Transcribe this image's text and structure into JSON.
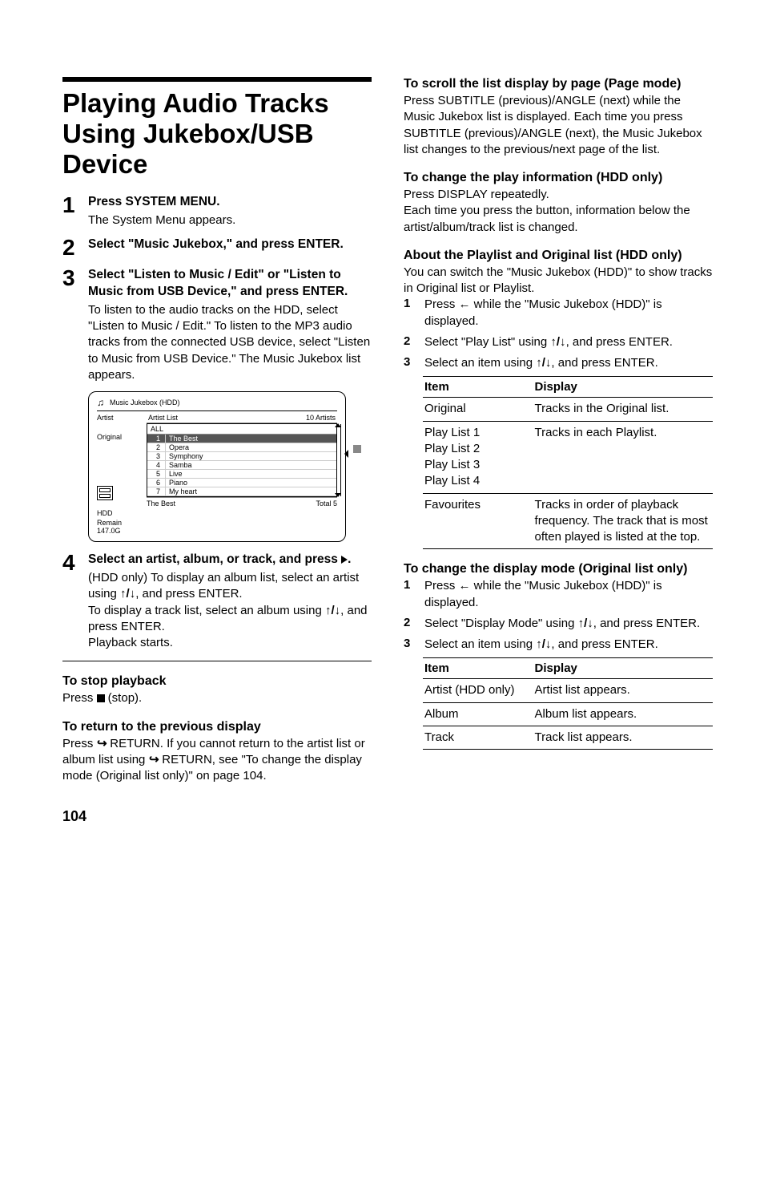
{
  "page_number": "104",
  "left": {
    "main_title": "Playing Audio Tracks Using Jukebox/USB Device",
    "steps": [
      {
        "num": "1",
        "head": "Press SYSTEM MENU.",
        "body": "The System Menu appears."
      },
      {
        "num": "2",
        "head": "Select \"Music Jukebox,\" and press ENTER.",
        "body": ""
      },
      {
        "num": "3",
        "head": "Select \"Listen to Music / Edit\" or \"Listen to Music from USB Device,\" and press ENTER.",
        "body": "To listen to the audio tracks on the HDD, select \"Listen to Music / Edit.\" To listen to the MP3 audio tracks from the connected USB device, select \"Listen to Music from USB Device.\" The Music Jukebox list appears."
      },
      {
        "num": "4",
        "head_a": "Select an artist, album, or track, and press ",
        "head_b": ".",
        "body_a": "(HDD only) To display an album list, select an artist using ",
        "body_b": ", and press ENTER.",
        "body_c": "To display a track list, select an album using ",
        "body_d": ", and press ENTER.",
        "body_e": "Playback starts."
      }
    ],
    "jukebox": {
      "title": "Music Jukebox (HDD)",
      "left_artist": "Artist",
      "left_original": "Original",
      "header_left": "Artist List",
      "header_right": "10 Artists",
      "all": "ALL",
      "items": [
        {
          "n": "1",
          "t": "The Best"
        },
        {
          "n": "2",
          "t": "Opera"
        },
        {
          "n": "3",
          "t": "Symphony"
        },
        {
          "n": "4",
          "t": "Samba"
        },
        {
          "n": "5",
          "t": "Live"
        },
        {
          "n": "6",
          "t": "Piano"
        },
        {
          "n": "7",
          "t": "My heart"
        }
      ],
      "footer_left": "The Best",
      "footer_right": "Total 5",
      "bottom_left": "HDD",
      "remain_label": "Remain",
      "remain_val": "147.0G"
    },
    "stop_h": "To stop playback",
    "stop_a": "Press ",
    "stop_b": " (stop).",
    "return_h": "To return to the previous display",
    "return_a": "Press ",
    "return_b": " RETURN. If you cannot return to the artist list or album list using ",
    "return_c": " RETURN, see \"To change the display mode (Original list only)\" on page 104."
  },
  "right": {
    "scroll_h": "To scroll the list display by page (Page mode)",
    "scroll_b": "Press SUBTITLE (previous)/ANGLE (next) while the Music Jukebox list is displayed. Each time you press SUBTITLE (previous)/ANGLE (next), the Music Jukebox list changes to the previous/next page of the list.",
    "change_info_h": "To change the play information (HDD only)",
    "change_info_b1": "Press DISPLAY repeatedly.",
    "change_info_b2": "Each time you press the button, information below the artist/album/track list is changed.",
    "about_h": "About the Playlist and Original list (HDD only)",
    "about_b": "You can switch the \"Music Jukebox (HDD)\" to show tracks in Original list or Playlist.",
    "substeps1": [
      {
        "n": "1",
        "a": "Press ",
        "b": " while the \"Music Jukebox (HDD)\" is displayed."
      },
      {
        "n": "2",
        "a": "Select \"Play List\" using ",
        "b": ", and press ENTER."
      },
      {
        "n": "3",
        "a": "Select an item using ",
        "b": ", and press ENTER."
      }
    ],
    "table1_h_item": "Item",
    "table1_h_disp": "Display",
    "table1": [
      {
        "item": "Original",
        "disp": "Tracks in the Original list."
      },
      {
        "item": "Play List 1\nPlay List 2\nPlay List 3\nPlay List 4",
        "disp": "Tracks in each Playlist."
      },
      {
        "item": "Favourites",
        "disp": "Tracks in order of playback frequency. The track that is most often played is listed at the top."
      }
    ],
    "mode_h": "To change the display mode (Original list only)",
    "substeps2": [
      {
        "n": "1",
        "a": "Press ",
        "b": " while the \"Music Jukebox (HDD)\" is displayed."
      },
      {
        "n": "2",
        "a": "Select \"Display Mode\" using ",
        "b": ", and press ENTER."
      },
      {
        "n": "3",
        "a": "Select an item using ",
        "b": ", and press ENTER."
      }
    ],
    "table2_h_item": "Item",
    "table2_h_disp": "Display",
    "table2": [
      {
        "item": "Artist (HDD only)",
        "disp": "Artist list appears."
      },
      {
        "item": "Album",
        "disp": "Album list appears."
      },
      {
        "item": "Track",
        "disp": "Track list appears."
      }
    ]
  }
}
